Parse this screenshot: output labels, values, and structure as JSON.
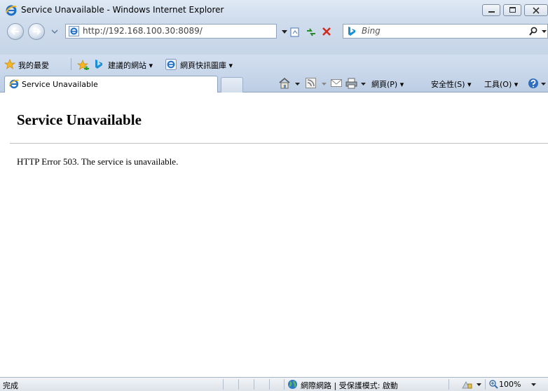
{
  "window": {
    "title": "Service Unavailable - Windows Internet Explorer"
  },
  "address_bar": {
    "url": "http://192.168.100.30:8089/",
    "search_placeholder": "Bing"
  },
  "favorites_bar": {
    "favorites_label": "我的最愛",
    "suggested_sites_label": "建議的網站 ▾",
    "web_slice_gallery_label": "網頁快訊圖庫 ▾"
  },
  "tab": {
    "label": "Service Unavailable"
  },
  "command_bar": {
    "page_menu": "網頁(P) ▾",
    "safety_menu": "安全性(S) ▾",
    "tools_menu": "工具(O) ▾"
  },
  "content": {
    "heading": "Service Unavailable",
    "error_message": "HTTP Error 503. The service is unavailable."
  },
  "status_bar": {
    "status_text": "完成",
    "zone_text": "網際網路 | 受保護模式: 啟動",
    "zoom": "100%"
  },
  "colors": {
    "chrome_blue": "#cfdcec",
    "ie_logo_blue": "#1f6fc5",
    "close_red": "#d42a1c"
  }
}
